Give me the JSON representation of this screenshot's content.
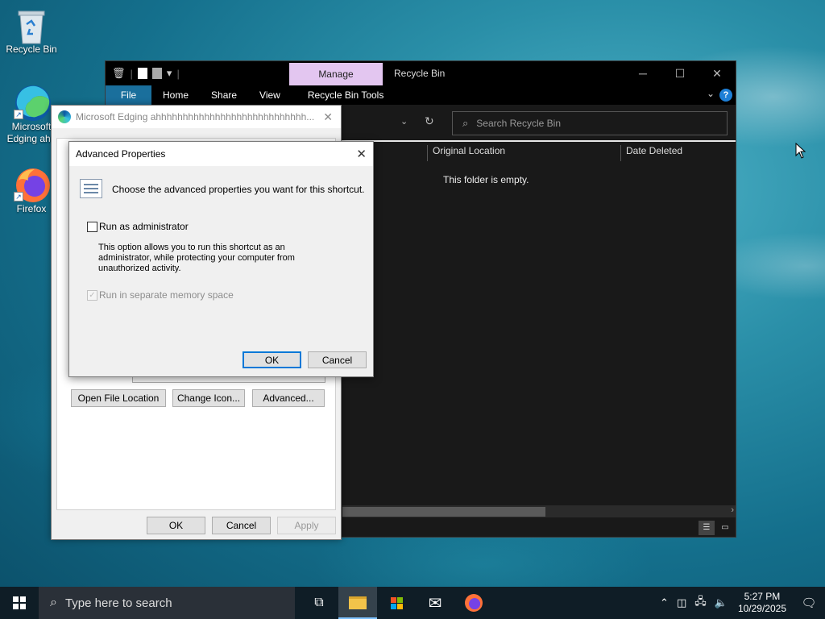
{
  "desktop": {
    "icons": [
      {
        "label": "Recycle Bin",
        "icon": "recycle-bin-icon"
      },
      {
        "label": "Microsoft Edging ahh",
        "icon": "edge-icon"
      },
      {
        "label": "Firefox",
        "icon": "firefox-icon"
      }
    ]
  },
  "explorer": {
    "manage_tab": "Manage",
    "title": "Recycle Bin",
    "ribbon_tabs": [
      "File",
      "Home",
      "Share",
      "View",
      "Recycle Bin Tools"
    ],
    "search_placeholder": "Search Recycle Bin",
    "columns": [
      "Original Location",
      "Date Deleted"
    ],
    "empty_message": "This folder is empty."
  },
  "properties": {
    "title": "Microsoft Edging ahhhhhhhhhhhhhhhhhhhhhhhhhhhh...",
    "buttons": {
      "open_file_location": "Open File Location",
      "change_icon": "Change Icon...",
      "advanced": "Advanced...",
      "ok": "OK",
      "cancel": "Cancel",
      "apply": "Apply"
    }
  },
  "advanced": {
    "title": "Advanced Properties",
    "instruction": "Choose the advanced properties you want for this shortcut.",
    "run_as_admin_label": "Run as administrator",
    "run_as_admin_checked": false,
    "description": "This option allows you to run this shortcut as an administrator, while protecting your computer from unauthorized activity.",
    "separate_memory_label": "Run in separate memory space",
    "separate_memory_checked": true,
    "ok": "OK",
    "cancel": "Cancel"
  },
  "taskbar": {
    "search_placeholder": "Type here to search",
    "time": "5:27 PM",
    "date": "10/29/2025"
  }
}
